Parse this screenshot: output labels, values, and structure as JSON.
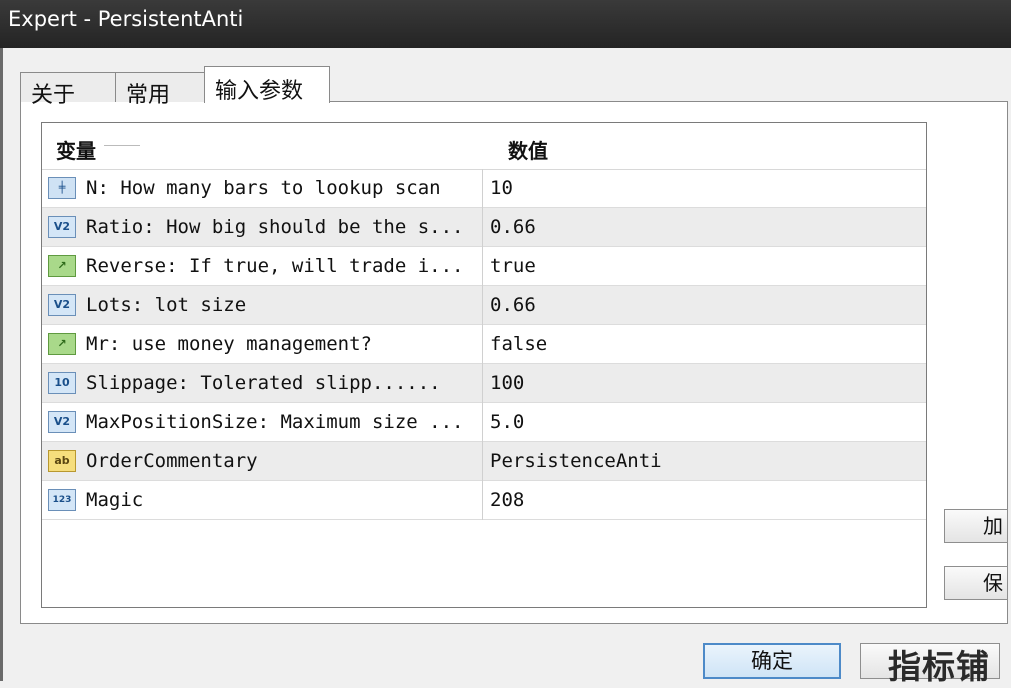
{
  "window": {
    "title": "Expert - PersistentAnti"
  },
  "tabs": [
    {
      "label": "关于"
    },
    {
      "label": "常用"
    },
    {
      "label": "输入参数",
      "active": true
    }
  ],
  "grid": {
    "headers": {
      "name": "变量",
      "value": "数值"
    },
    "rows": [
      {
        "icon": "grid-icon",
        "icon_text": "╪",
        "name": "N: How many bars to lookup scan",
        "value": "10"
      },
      {
        "icon": "v2-icon",
        "icon_text": "V2",
        "name": "Ratio: How big should be the s...",
        "value": "0.66"
      },
      {
        "icon": "toggle-icon",
        "icon_text": "↗",
        "name": "Reverse: If true, will trade i...",
        "value": "true"
      },
      {
        "icon": "v2-icon",
        "icon_text": "V2",
        "name": "Lots: lot size",
        "value": "0.66"
      },
      {
        "icon": "toggle-icon",
        "icon_text": "↗",
        "name": "Mr: use money management?",
        "value": "false"
      },
      {
        "icon": "int-icon",
        "icon_text": "10",
        "name": "Slippage: Tolerated slipp......",
        "value": "100"
      },
      {
        "icon": "v2-icon",
        "icon_text": "V2",
        "name": "MaxPositionSize: Maximum size ...",
        "value": "5.0"
      },
      {
        "icon": "string-icon",
        "icon_text": "ab",
        "name": "OrderCommentary",
        "value": "PersistenceAnti"
      },
      {
        "icon": "number-icon",
        "icon_text": "123",
        "name": "Magic",
        "value": "208"
      }
    ]
  },
  "side_buttons": [
    {
      "label": "加"
    },
    {
      "label": "保"
    }
  ],
  "footer": {
    "ok_label": "确定",
    "watermark": "指标铺"
  }
}
